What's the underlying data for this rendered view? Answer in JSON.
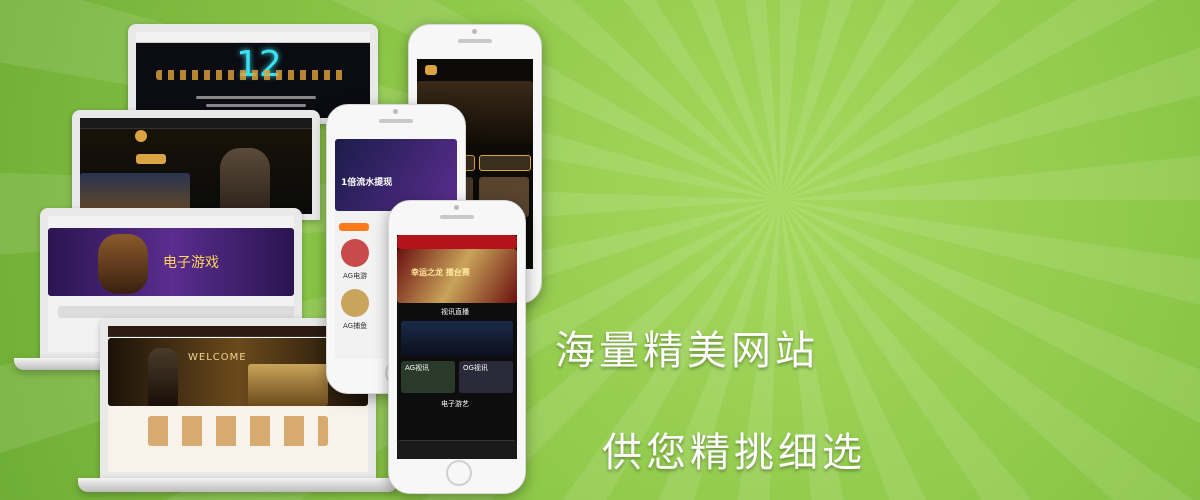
{
  "colors": {
    "bg": "#8fc94a",
    "dark_screen": "#111111",
    "gold": "#d9a441",
    "red": "#b3141c"
  },
  "headline": {
    "line1": "海量精美网站",
    "line2": "供您精挑细选"
  },
  "laptop1": {
    "big_number": "12"
  },
  "laptop3": {
    "banner": "电子游戏"
  },
  "laptop4": {
    "banner": "WELCOME"
  },
  "phone_mid": {
    "banner": "1倍流水提现",
    "label1": "AG电游",
    "label2": "AG捕鱼"
  },
  "phone_front": {
    "banner": "幸运之龙 擂台赛",
    "section1": "视讯直播",
    "section2": "电子游艺",
    "cell1": "AG视讯",
    "cell2": "OG视讯"
  }
}
